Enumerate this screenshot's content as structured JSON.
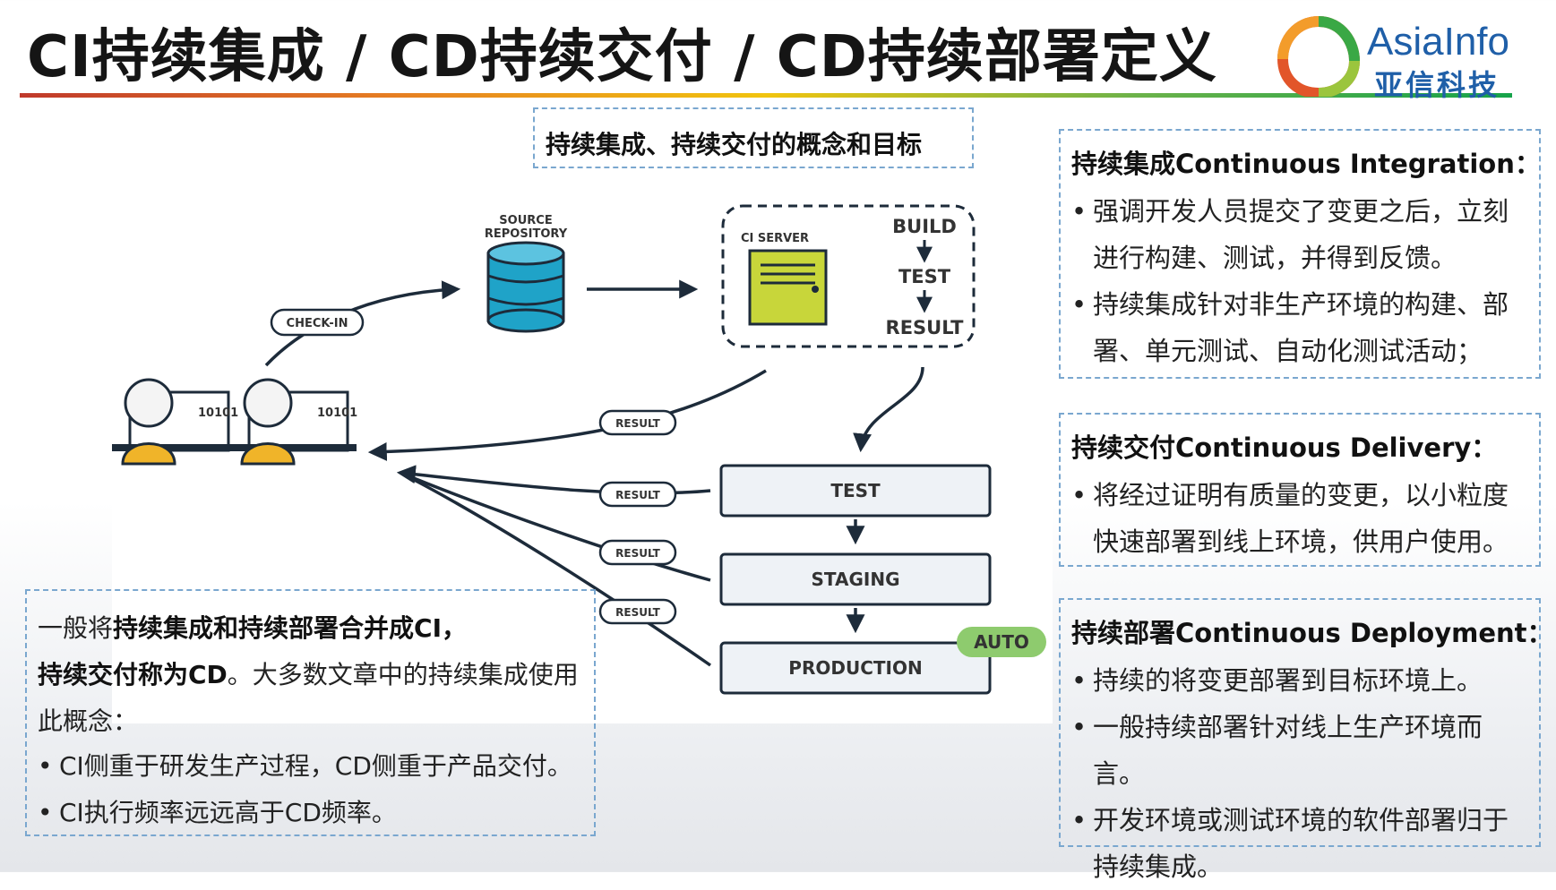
{
  "slide_title": "CI持续集成 / CD持续交付 / CD持续部署定义",
  "logo": {
    "en": "AsiaInfo",
    "cn": "亚信科技"
  },
  "concept_box": "持续集成、持续交付的概念和目标",
  "diagram": {
    "source_repo_line1": "SOURCE",
    "source_repo_line2": "REPOSITORY",
    "check_in": "CHECK-IN",
    "ci_server": "CI SERVER",
    "build": "BUILD",
    "test_small": "TEST",
    "result_small": "RESULT",
    "result_label": "RESULT",
    "dev_code": "10101",
    "stages": [
      "TEST",
      "STAGING",
      "PRODUCTION"
    ],
    "auto": "AUTO"
  },
  "ci": {
    "title": "持续集成Continuous Integration：",
    "items": [
      "强调开发人员提交了变更之后，立刻进行构建、测试，并得到反馈。",
      "持续集成针对非生产环境的构建、部署、单元测试、自动化测试活动；"
    ]
  },
  "delivery": {
    "title": "持续交付Continuous Delivery：",
    "items": [
      "将经过证明有质量的变更，以小粒度快速部署到线上环境，供用户使用。"
    ]
  },
  "deployment": {
    "title": "持续部署Continuous Deployment：",
    "items": [
      "持续的将变更部署到目标环境上。",
      "一般持续部署针对线上生产环境而言。",
      "开发环境或测试环境的软件部署归于持续集成。"
    ]
  },
  "note": {
    "p1_prefix": "一般将",
    "p1_bold1": "持续集成和持续部署合并成CI，",
    "p1_bold2": "持续交付称为CD",
    "p1_suffix": "。大多数文章中的持续集成使用此概念：",
    "items": [
      "CI侧重于研发生产过程，CD侧重于产品交付。",
      "CI执行频率远远高于CD频率。"
    ]
  },
  "colors": {
    "db": "#1fa3c8",
    "server": "#c8d63a",
    "auto": "#8ecb6e",
    "rule_start": "#c0392b",
    "rule_end": "#16a34a"
  }
}
